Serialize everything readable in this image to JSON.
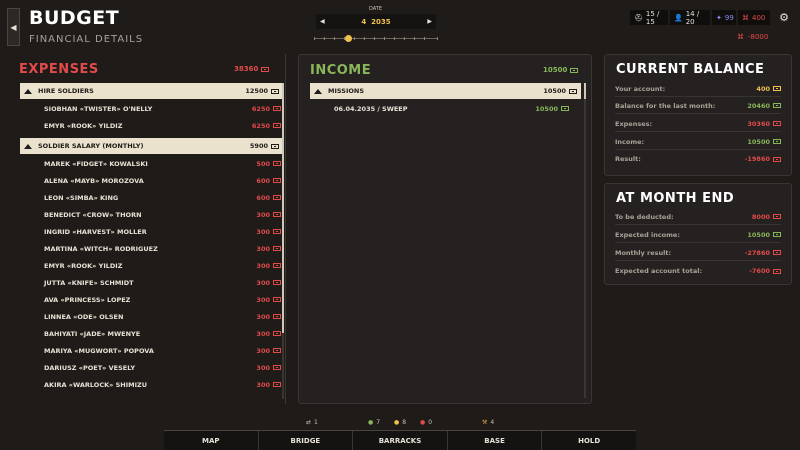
{
  "header": {
    "title": "BUDGET",
    "subtitle": "FINANCIAL DETAILS",
    "back_icon": "chevron-left-icon"
  },
  "date": {
    "label": "DATE",
    "month": "4",
    "year": "2035"
  },
  "stats": {
    "soldiers": "15 / 15",
    "staff": "14 / 20",
    "intel": "99",
    "money": "400",
    "money_change": "-8000"
  },
  "expenses": {
    "title": "EXPENSES",
    "total": "38360",
    "categories": [
      {
        "label": "HIRE SOLDIERS",
        "amount": "12500",
        "items": [
          {
            "name": "SIOBHAN «TWISTER» O'NELLY",
            "amount": "6250"
          },
          {
            "name": "EMYR «ROOK» YILDIZ",
            "amount": "6250"
          }
        ]
      },
      {
        "label": "SOLDIER SALARY (MONTHLY)",
        "amount": "5900",
        "items": [
          {
            "name": "MAREK «FIDGET» KOWALSKI",
            "amount": "500"
          },
          {
            "name": "ALENA «MAYB» MOROZOVA",
            "amount": "600"
          },
          {
            "name": "LEON «SIMBA» KING",
            "amount": "600"
          },
          {
            "name": "BENEDICT «CROW» THORN",
            "amount": "300"
          },
          {
            "name": "INGRID «HARVEST» MOLLER",
            "amount": "300"
          },
          {
            "name": "MARTINA «WITCH» RODRIGUEZ",
            "amount": "300"
          },
          {
            "name": "EMYR «ROOK» YILDIZ",
            "amount": "300"
          },
          {
            "name": "JUTTA «KNIFE» SCHMIDT",
            "amount": "300"
          },
          {
            "name": "AVA «PRINCESS» LOPEZ",
            "amount": "300"
          },
          {
            "name": "LINNEA «ODE» OLSEN",
            "amount": "300"
          },
          {
            "name": "BAHIYATI «JADE» MWENYE",
            "amount": "300"
          },
          {
            "name": "MARIYA «MUGWORT» POPOVA",
            "amount": "300"
          },
          {
            "name": "DARIUSZ «POET» VESELY",
            "amount": "300"
          },
          {
            "name": "AKIRA «WARLOCK» SHIMIZU",
            "amount": "300"
          }
        ]
      }
    ]
  },
  "income": {
    "title": "INCOME",
    "total": "10500",
    "categories": [
      {
        "label": "MISSIONS",
        "amount": "10500",
        "items": [
          {
            "name": "06.04.2035 / SWEEP",
            "amount": "10500"
          }
        ]
      }
    ]
  },
  "current_balance": {
    "title": "CURRENT BALANCE",
    "rows": [
      {
        "label": "Your account:",
        "value": "400",
        "color": "#f2c14e"
      },
      {
        "label": "Balance for the last month:",
        "value": "20460",
        "color": "#8ab65a"
      },
      {
        "label": "Expenses:",
        "value": "30360",
        "color": "#e34b4b"
      },
      {
        "label": "Income:",
        "value": "10500",
        "color": "#8ab65a"
      },
      {
        "label": "Result:",
        "value": "-19860",
        "color": "#e34b4b"
      }
    ]
  },
  "month_end": {
    "title": "AT MONTH END",
    "rows": [
      {
        "label": "To be deducted:",
        "value": "8000",
        "color": "#e34b4b"
      },
      {
        "label": "Expected income:",
        "value": "10500",
        "color": "#8ab65a"
      },
      {
        "label": "Monthly result:",
        "value": "-27860",
        "color": "#e34b4b"
      },
      {
        "label": "Expected account total:",
        "value": "-7600",
        "color": "#e34b4b"
      }
    ]
  },
  "bottom": {
    "badges": [
      "1",
      "7",
      "8",
      "0",
      "4"
    ],
    "tabs": [
      "MAP",
      "BRIDGE",
      "BARRACKS",
      "BASE",
      "HOLD"
    ]
  },
  "colors": {
    "expense": "#e34b4b",
    "income": "#8ab65a",
    "accent": "#f2c14e",
    "category_bg": "#eae2cc"
  }
}
